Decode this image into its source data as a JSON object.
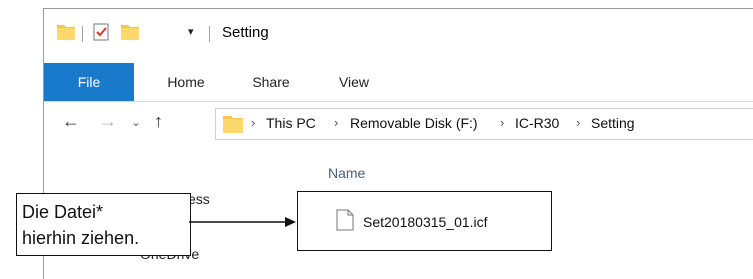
{
  "window": {
    "title": "Setting",
    "quick_access": [
      "folder-icon",
      "properties-check-icon",
      "new-folder-icon",
      "customize-dropdown-icon"
    ]
  },
  "ribbon": {
    "tabs": [
      "File",
      "Home",
      "Share",
      "View"
    ],
    "active_tab": "File",
    "accent_color": "#1979ca"
  },
  "navigation": {
    "back_icon": "back-arrow-icon",
    "forward_icon": "forward-arrow-icon",
    "recent_icon": "recent-dropdown-icon",
    "up_icon": "up-arrow-icon"
  },
  "address": {
    "breadcrumbs": [
      "This PC",
      "Removable Disk (F:)",
      "IC-R30",
      "Setting"
    ]
  },
  "nav_pane": {
    "partial_quick_access": "cess",
    "partial_item": "OneDrive"
  },
  "file_list": {
    "column_header": "Name",
    "files": [
      {
        "name": "Set20180315_01.icf",
        "icon": "file-icon"
      }
    ]
  },
  "callout": {
    "line1": "Die Datei*",
    "line2": "hierhin ziehen."
  }
}
